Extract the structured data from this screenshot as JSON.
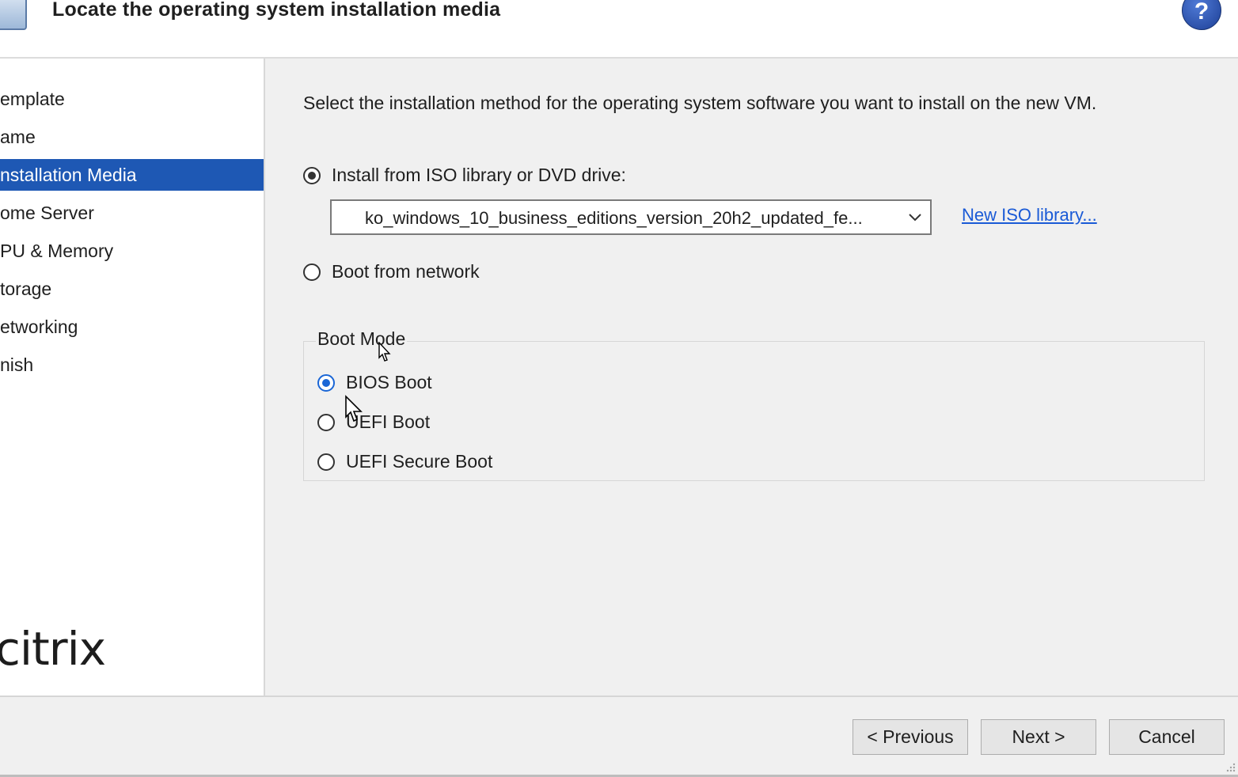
{
  "header": {
    "title": "Locate the operating system installation media",
    "help_label": "?"
  },
  "sidebar": {
    "items": [
      {
        "label": "emplate"
      },
      {
        "label": "ame"
      },
      {
        "label": "nstallation Media"
      },
      {
        "label": "ome Server"
      },
      {
        "label": "PU & Memory"
      },
      {
        "label": "torage"
      },
      {
        "label": "etworking"
      },
      {
        "label": "nish"
      }
    ],
    "active_index": 2,
    "logo_text": "citrix"
  },
  "main": {
    "instruction": "Select the installation method for the operating system software you want to install on the new VM.",
    "install_iso_label": "Install from ISO library or DVD drive:",
    "iso_selected": "ko_windows_10_business_editions_version_20h2_updated_fe...",
    "new_iso_link": "New ISO library...",
    "boot_network_label": "Boot from network",
    "boot_mode": {
      "legend": "Boot Mode",
      "bios_label": "BIOS Boot",
      "uefi_label": "UEFI Boot",
      "uefi_secure_label": "UEFI Secure Boot"
    }
  },
  "footer": {
    "previous_label": "< Previous",
    "next_label": "Next >",
    "cancel_label": "Cancel"
  },
  "colors": {
    "accent": "#1e58b4",
    "link": "#1a5ad6",
    "panel_bg": "#f0f0f0"
  }
}
